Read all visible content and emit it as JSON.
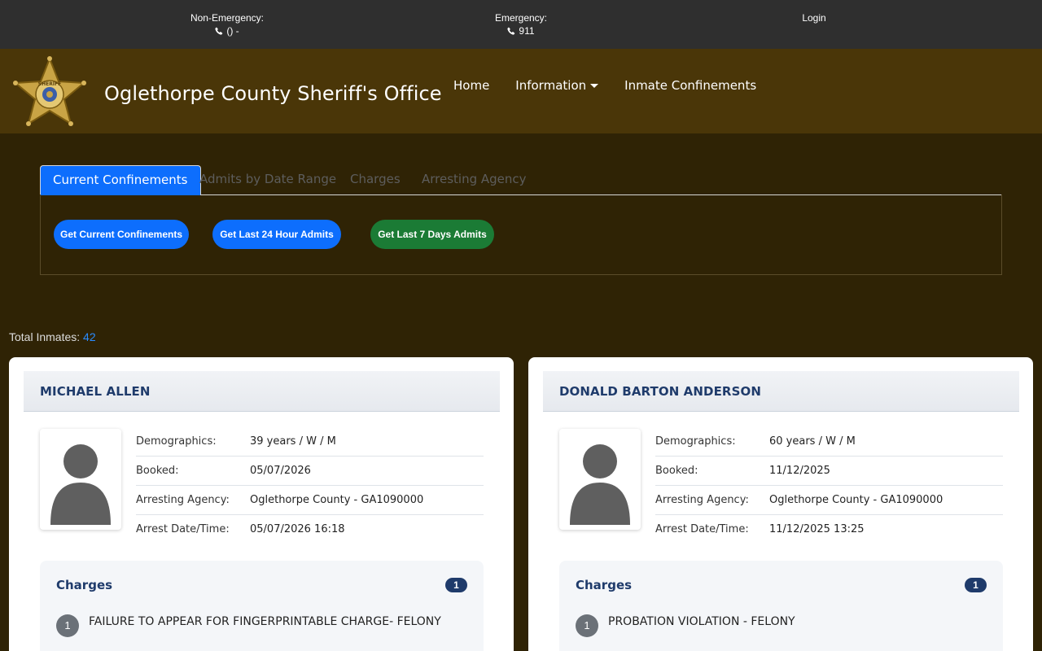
{
  "topbar": {
    "non_emergency_label": "Non-Emergency:",
    "non_emergency_phone": "() -",
    "emergency_label": "Emergency:",
    "emergency_phone": "911",
    "login": "Login"
  },
  "header": {
    "logo_text": "SHERIFF",
    "title": "Oglethorpe County Sheriff's Office",
    "nav": {
      "home": "Home",
      "information": "Information",
      "inmate_confinements": "Inmate Confinements"
    }
  },
  "tabs": {
    "current": "Current Confinements",
    "admits": "Admits by Date Range",
    "charges": "Charges",
    "agency": "Arresting Agency"
  },
  "buttons": {
    "current": "Get Current Confinements",
    "last24": "Get Last 24 Hour Admits",
    "last7": "Get Last 7 Days Admits"
  },
  "total": {
    "label": "Total Inmates:",
    "count": "42"
  },
  "labels": {
    "demographics": "Demographics:",
    "booked": "Booked:",
    "agency": "Arresting Agency:",
    "arrest": "Arrest Date/Time:",
    "charges": "Charges"
  },
  "inmates": [
    {
      "name": "MICHAEL ALLEN",
      "demographics": "39 years / W / M",
      "booked": "05/07/2026",
      "agency": "Oglethorpe County - GA1090000",
      "arrest": "05/07/2026 16:18",
      "charge_count": "1",
      "charges": [
        {
          "num": "1",
          "text": "FAILURE TO APPEAR FOR FINGERPRINTABLE CHARGE- FELONY"
        }
      ]
    },
    {
      "name": "DONALD BARTON ANDERSON",
      "demographics": "60 years / W / M",
      "booked": "11/12/2025",
      "agency": "Oglethorpe County - GA1090000",
      "arrest": "11/12/2025 13:25",
      "charge_count": "1",
      "charges": [
        {
          "num": "1",
          "text": "PROBATION VIOLATION - FELONY"
        }
      ]
    }
  ]
}
